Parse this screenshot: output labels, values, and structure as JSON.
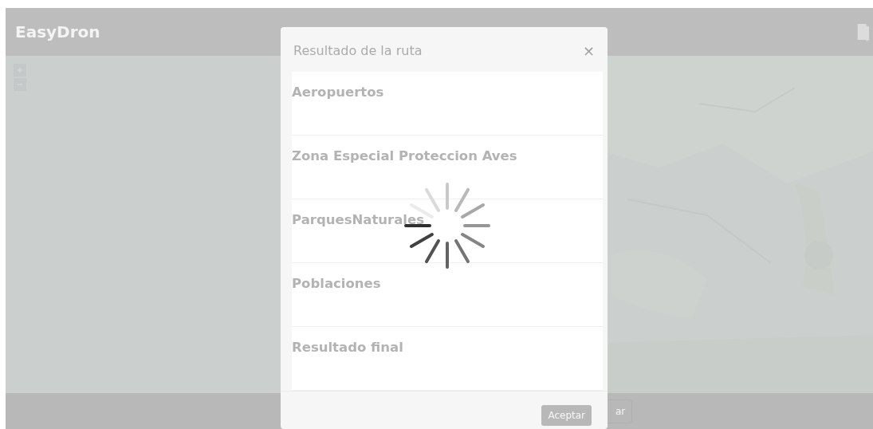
{
  "navbar": {
    "brand": "EasyDron"
  },
  "bottom_bar": {
    "buttons": [
      {
        "label": "ar"
      }
    ]
  },
  "modal": {
    "title": "Resultado de la ruta",
    "close": "×",
    "loading": true,
    "sections": [
      {
        "title": "Aeropuertos"
      },
      {
        "title": "Zona Especial Proteccion Aves"
      },
      {
        "title": "ParquesNaturales"
      },
      {
        "title": "Poblaciones"
      },
      {
        "title": "Resultado final"
      }
    ],
    "buttons": [
      "Aceptar"
    ]
  }
}
